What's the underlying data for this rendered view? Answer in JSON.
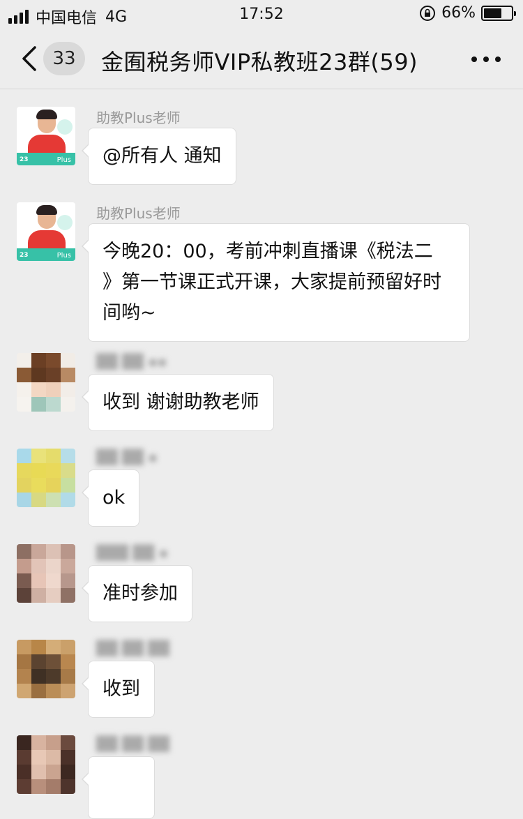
{
  "status_bar": {
    "carrier": "中国电信",
    "network": "4G",
    "time": "17:52",
    "battery_percent": "66%",
    "battery_level": 0.66
  },
  "nav": {
    "back_icon": "chevron-left-icon",
    "unread_count": "33",
    "title": "金囿税务师VIP私教班23群(59)",
    "more_icon": "more-dots-icon"
  },
  "messages": [
    {
      "sender": "助教Plus老师",
      "text": "@所有人 通知"
    },
    {
      "sender": "助教Plus老师",
      "text_lines": [
        "今晚20：00，考前冲刺直播课《税法二",
        "》第一节课正式开课，大家提前预留好时",
        "间哟~"
      ]
    },
    {
      "sender": "",
      "text": "收到 谢谢助教老师"
    },
    {
      "sender": "",
      "text": "ok"
    },
    {
      "sender": "",
      "text": "准时参加"
    },
    {
      "sender": "",
      "text": "收到"
    },
    {
      "sender": "",
      "text": ""
    }
  ],
  "avatar_logo": {
    "brand": "Plus"
  },
  "colors": {
    "background": "#ededed",
    "bubble": "#ffffff",
    "accent_teal": "#37c1a7"
  }
}
